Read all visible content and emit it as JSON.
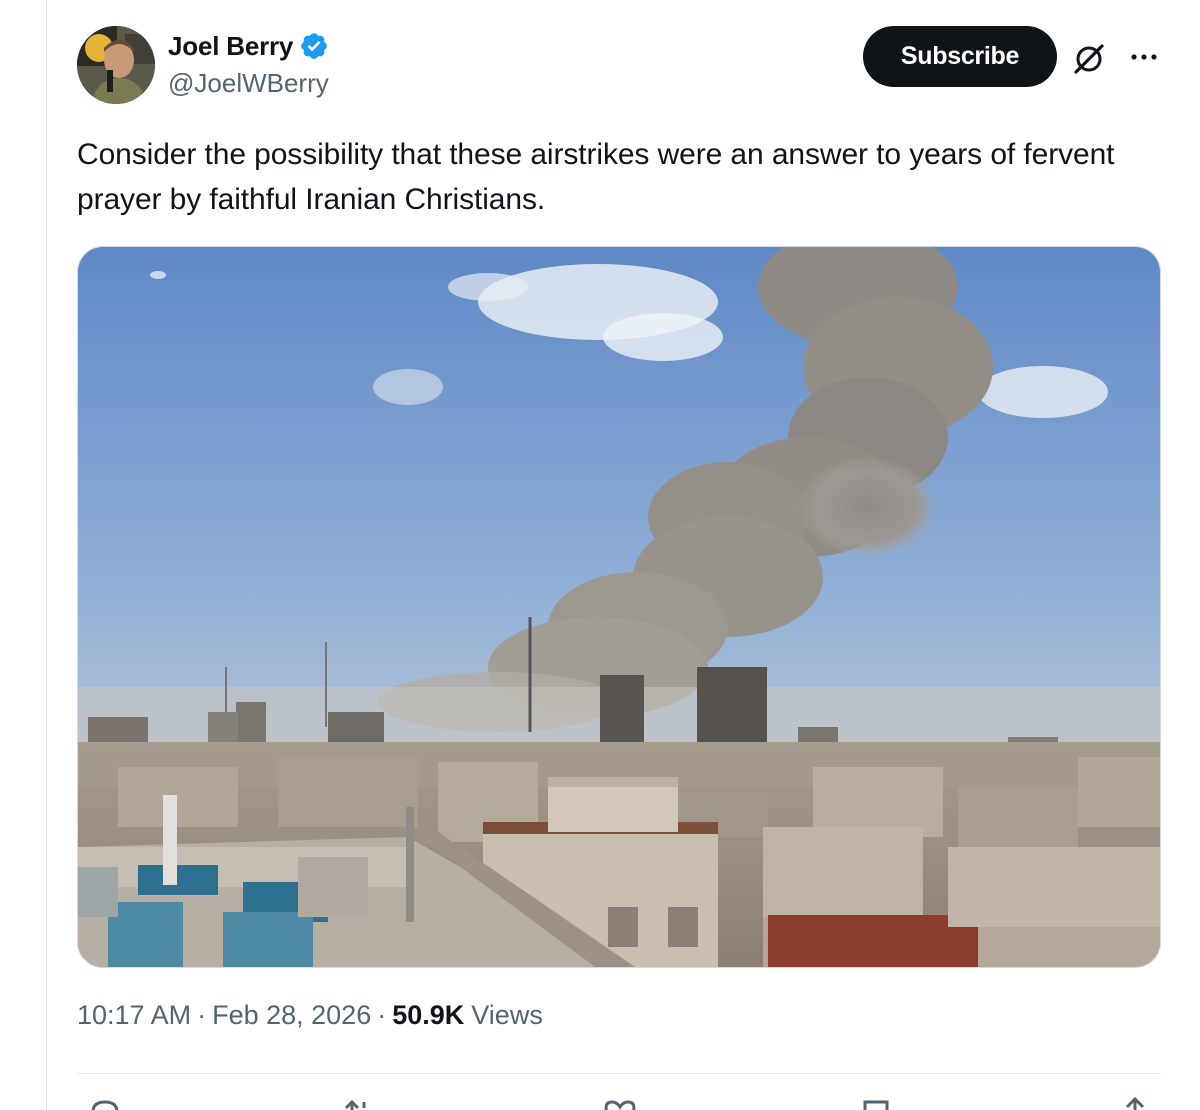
{
  "author": {
    "display_name": "Joel Berry",
    "handle": "@JoelWBerry",
    "verified_color": "#1d9bf0"
  },
  "header_actions": {
    "subscribe_label": "Subscribe",
    "grok_icon": "grok-icon",
    "more_icon": "more-icon"
  },
  "tweet": {
    "text": "Consider the possibility that these airstrikes were an answer to years of fervent prayer by faithful Iranian Christians."
  },
  "meta": {
    "time": "10:17 AM",
    "date": "Feb 28, 2026",
    "views_count": "50.9K",
    "views_label": "Views",
    "separator": "·"
  },
  "actions": [
    {
      "icon": "reply-icon"
    },
    {
      "icon": "repost-icon"
    },
    {
      "icon": "like-icon"
    },
    {
      "icon": "bookmark-icon"
    },
    {
      "icon": "share-icon"
    }
  ],
  "colors": {
    "text": "#0f1419",
    "secondary": "#536471",
    "button_bg": "#0f1419",
    "divider": "#e7e9ea"
  }
}
